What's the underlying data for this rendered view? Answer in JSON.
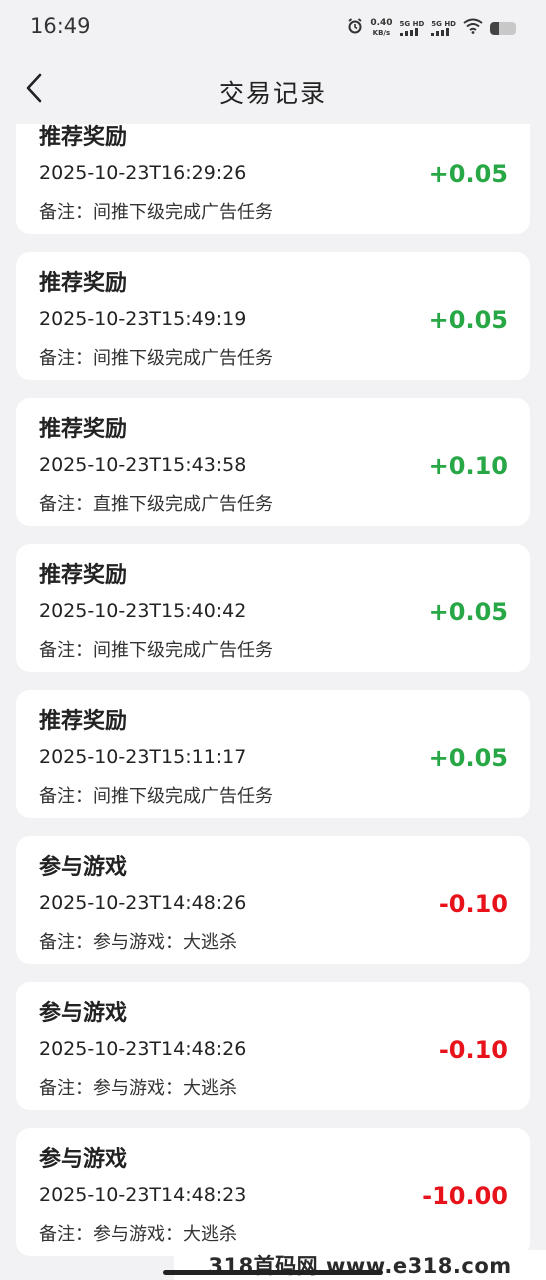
{
  "status_bar": {
    "time": "16:49",
    "net_speed_value": "0.40",
    "net_speed_unit": "KB/s",
    "sim1": "5G HD",
    "sim2": "5G HD",
    "battery_level": 0.35
  },
  "header": {
    "title": "交易记录"
  },
  "colors": {
    "positive": "#27a745",
    "negative": "#e8121b"
  },
  "records": [
    {
      "title": "推荐奖励",
      "time": "2025-10-23T16:29:26",
      "note": "备注：间推下级完成广告任务",
      "amount": "+0.05",
      "kind": "positive"
    },
    {
      "title": "推荐奖励",
      "time": "2025-10-23T15:49:19",
      "note": "备注：间推下级完成广告任务",
      "amount": "+0.05",
      "kind": "positive"
    },
    {
      "title": "推荐奖励",
      "time": "2025-10-23T15:43:58",
      "note": "备注：直推下级完成广告任务",
      "amount": "+0.10",
      "kind": "positive"
    },
    {
      "title": "推荐奖励",
      "time": "2025-10-23T15:40:42",
      "note": "备注：间推下级完成广告任务",
      "amount": "+0.05",
      "kind": "positive"
    },
    {
      "title": "推荐奖励",
      "time": "2025-10-23T15:11:17",
      "note": "备注：间推下级完成广告任务",
      "amount": "+0.05",
      "kind": "positive"
    },
    {
      "title": "参与游戏",
      "time": "2025-10-23T14:48:26",
      "note": "备注：参与游戏：大逃杀",
      "amount": "-0.10",
      "kind": "negative"
    },
    {
      "title": "参与游戏",
      "time": "2025-10-23T14:48:26",
      "note": "备注：参与游戏：大逃杀",
      "amount": "-0.10",
      "kind": "negative"
    },
    {
      "title": "参与游戏",
      "time": "2025-10-23T14:48:23",
      "note": "备注：参与游戏：大逃杀",
      "amount": "-10.00",
      "kind": "negative"
    }
  ],
  "watermark": "318首码网 www.e318.com"
}
